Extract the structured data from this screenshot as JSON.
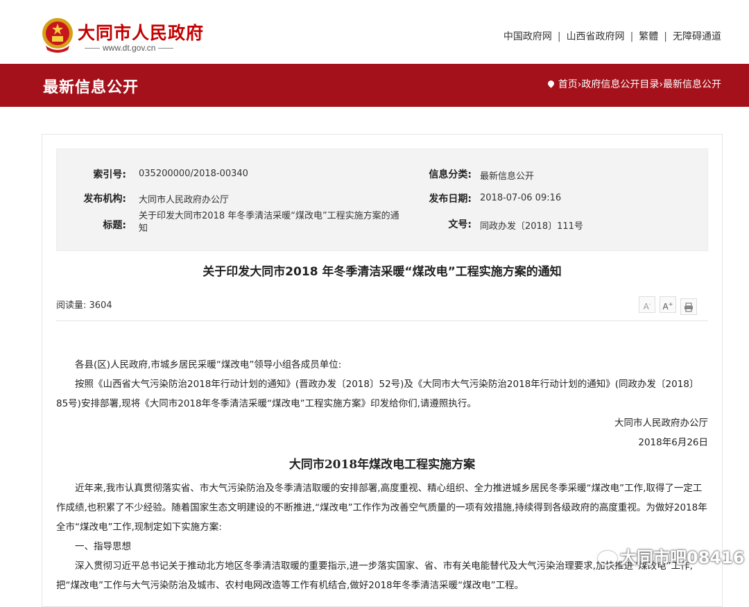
{
  "header": {
    "site_name": "大同市人民政府",
    "site_url": "www.dt.gov.cn",
    "links": [
      "中国政府网",
      "山西省政府网",
      "繁體",
      "无障碍通道"
    ]
  },
  "banner": {
    "title": "最新信息公开",
    "breadcrumb": "首页›政府信息公开目录›最新信息公开"
  },
  "meta": {
    "index_label": "索引号:",
    "index_value": "035200000/2018-00340",
    "category_label": "信息分类:",
    "category_value": "最新信息公开",
    "org_label": "发布机构:",
    "org_value": "大同市人民政府办公厅",
    "date_label": "发布日期:",
    "date_value": "2018-07-06 09:16",
    "title_label": "标题:",
    "title_value": "关于印发大同市2018 年冬季清洁采暖“煤改电”工程实施方案的通知",
    "docno_label": "文号:",
    "docno_value": "同政办发〔2018〕111号"
  },
  "document": {
    "title": "关于印发大同市2018 年冬季清洁采暖“煤改电”工程实施方案的通知",
    "read_count": "阅读量: 3604",
    "tools": [
      "A-",
      "A+",
      "print"
    ],
    "salutation": "各县(区)人民政府,市城乡居民采暖“煤改电”领导小组各成员单位:",
    "para1": "按照《山西省大气污染防治2018年行动计划的通知》(晋政办发〔2018〕52号)及《大同市大气污染防治2018年行动计划的通知》(同政办发〔2018〕85号)安排部署,现将《大同市2018年冬季清洁采暖“煤改电”工程实施方案》印发给你们,请遵照执行。",
    "signer": "大同市人民政府办公厅",
    "sign_date": "2018年6月26日",
    "plan_title": "大同市2018年煤改电工程实施方案",
    "para2": "近年来,我市认真贯彻落实省、市大气污染防治及冬季清洁取暖的安排部署,高度重视、精心组织、全力推进城乡居民冬季采暖“煤改电”工作,取得了一定工作成绩,也积累了不少经验。随着国家生态文明建设的不断推进,“煤改电”工作作为改善空气质量的一项有效措施,持续得到各级政府的高度重视。为做好2018年全市“煤改电”工作,现制定如下实施方案:",
    "section1": "一、指导思想",
    "para3": "深入贯彻习近平总书记关于推动北方地区冬季清洁取暖的重要指示,进一步落实国家、省、市有关电能替代及大气污染治理要求,加快推进“煤改电”工作,把“煤改电”工作与大气污染防治及城市、农村电网改造等工作有机结合,做好2018年冬季清洁采暖“煤改电”工程。"
  },
  "watermark": "大同市吧08416"
}
